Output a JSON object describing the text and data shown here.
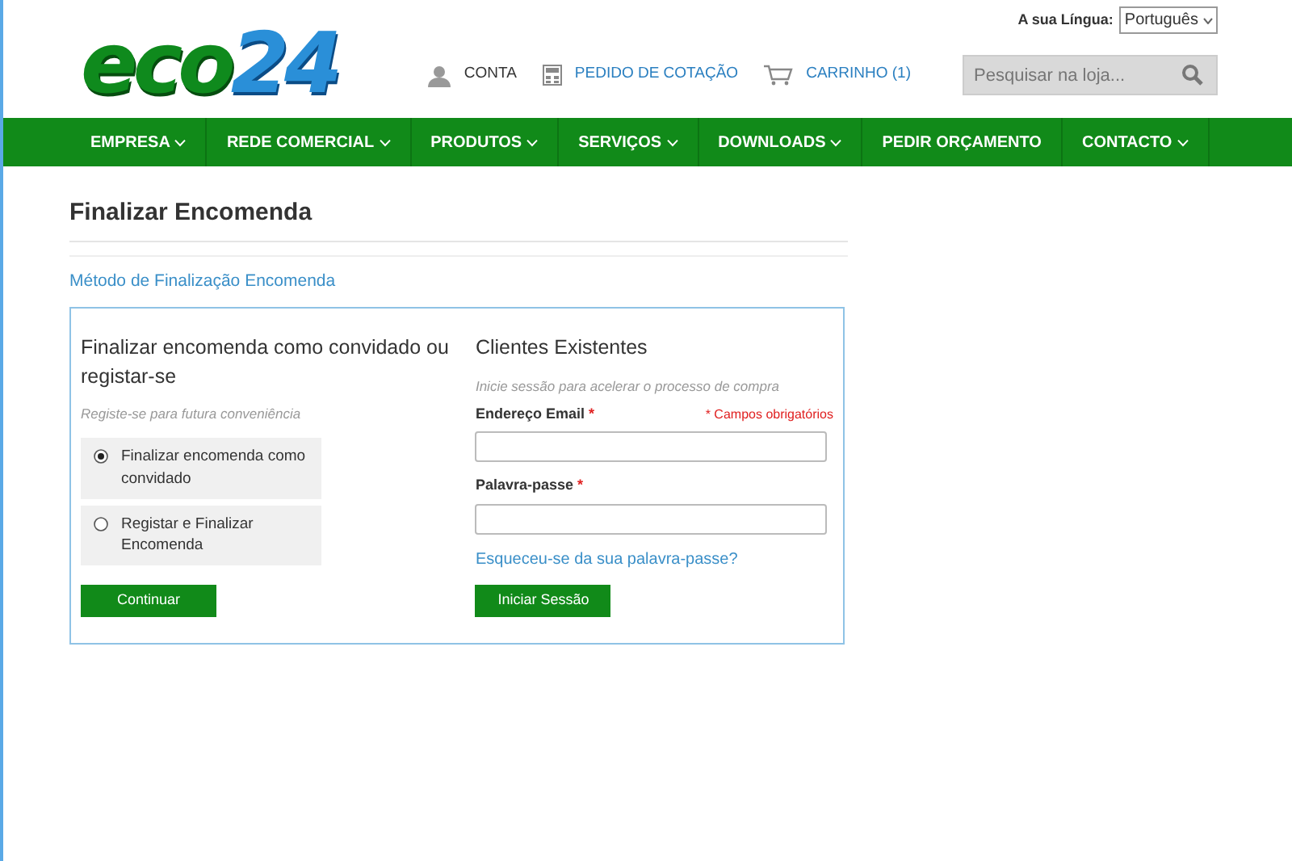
{
  "language": {
    "label": "A sua Língua:",
    "value": "Português"
  },
  "logo": {
    "part_1": "eco",
    "part_2": "24"
  },
  "header_links": [
    {
      "kind": "user",
      "label": "CONTA"
    },
    {
      "kind": "calculator",
      "label": "PEDIDO DE COTAÇÃO"
    },
    {
      "kind": "cart",
      "label": "CARRINHO (1)"
    }
  ],
  "search": {
    "placeholder": "Pesquisar na loja..."
  },
  "nav": [
    {
      "label": "EMPRESA",
      "has_dropdown": true
    },
    {
      "label": "REDE COMERCIAL",
      "has_dropdown": true
    },
    {
      "label": "PRODUTOS",
      "has_dropdown": true
    },
    {
      "label": "SERVIÇOS",
      "has_dropdown": true
    },
    {
      "label": "DOWNLOADS",
      "has_dropdown": true
    },
    {
      "label": "PEDIR ORÇAMENTO",
      "has_dropdown": false
    },
    {
      "label": "CONTACTO",
      "has_dropdown": true
    }
  ],
  "page_title": "Finalizar Encomenda",
  "section_title": "Método de Finalização Encomenda",
  "guest": {
    "title": "Finalizar encomenda como convidado ou registar-se",
    "hint": "Registe-se para futura conveniência",
    "options": [
      {
        "label": "Finalizar encomenda como convidado",
        "selected": true
      },
      {
        "label": "Registar e Finalizar Encomenda",
        "selected": false
      }
    ],
    "button": "Continuar"
  },
  "login": {
    "title": "Clientes Existentes",
    "hint": "Inicie sessão para acelerar o processo de compra",
    "required_note": "* Campos obrigatórios",
    "fields": [
      {
        "label": "Endereço Email",
        "required_mark": "*"
      },
      {
        "label": "Palavra-passe",
        "required_mark": "*"
      }
    ],
    "forgot_link": "Esqueceu-se da sua palavra-passe?",
    "button": "Iniciar Sessão"
  }
}
